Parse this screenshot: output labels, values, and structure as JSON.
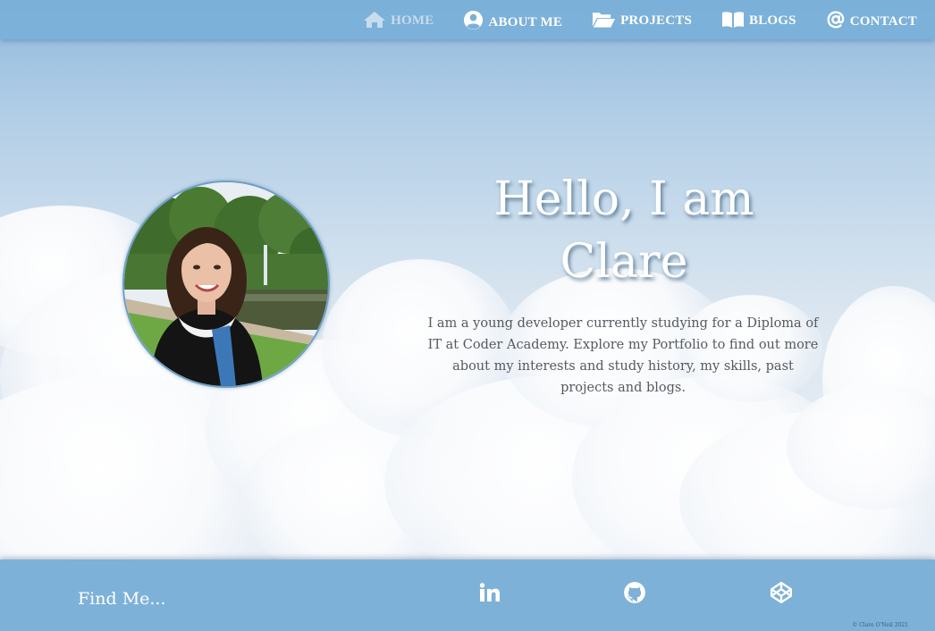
{
  "nav": {
    "items": [
      {
        "label": "HOME",
        "icon": "home-icon",
        "active": true
      },
      {
        "label": "ABOUT ME",
        "icon": "user-circle-icon",
        "active": false
      },
      {
        "label": "PROJECTS",
        "icon": "folder-open-icon",
        "active": false
      },
      {
        "label": "BLOGS",
        "icon": "open-book-icon",
        "active": false
      },
      {
        "label": "CONTACT",
        "icon": "at-sign-icon",
        "active": false
      }
    ]
  },
  "hero": {
    "title_line1": "Hello, I am",
    "title_line2": "Clare",
    "intro": "I am a young developer currently studying for a Diploma of IT at Coder Academy. Explore my Portfolio to find out more about my interests and study history, my skills, past projects and blogs.",
    "photo": "profile-photo"
  },
  "footer": {
    "find_me": "Find Me...",
    "social": [
      {
        "icon": "linkedin-icon"
      },
      {
        "icon": "github-icon"
      },
      {
        "icon": "codepen-icon"
      }
    ],
    "copyright": "© Clare O'Neil 2021"
  },
  "colors": {
    "nav_bg": "#7ab0d8",
    "footer_bg": "#7db1d8",
    "nav_active": "#c7dcec",
    "text_white": "#ffffff",
    "body_text": "#555a60"
  }
}
